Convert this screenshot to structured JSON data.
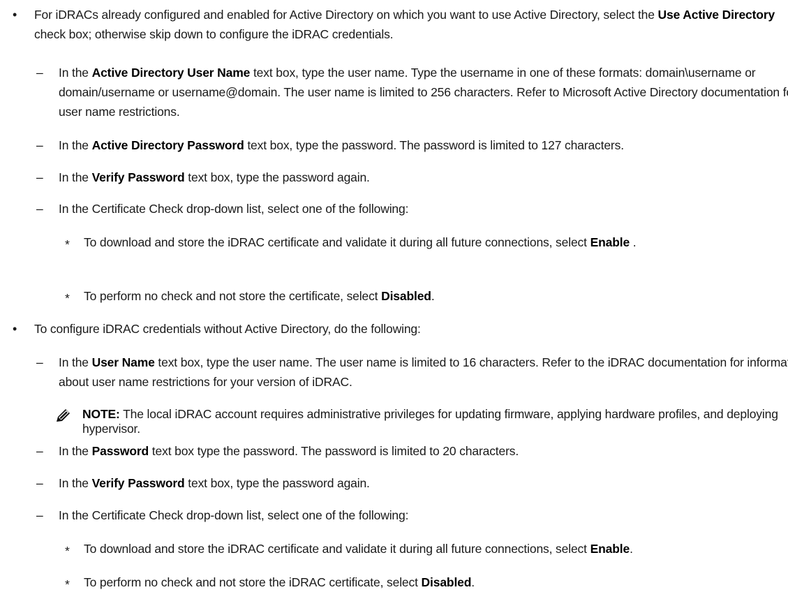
{
  "bullets": {
    "ad": {
      "mark": "•",
      "pre": "For iDRACs already configured and enabled for Active Directory on which you want to use Active Directory, select the ",
      "bold": "Use Active Directory",
      "post": " check box; otherwise skip down to configure the iDRAC credentials.",
      "subs": {
        "username": {
          "mark": "–",
          "pre": "In the ",
          "bold": "Active Directory User Name",
          "post": " text box, type the user name. Type the username in one of these formats: domain\\username or domain/username or username@domain. The user name is limited to 256 characters. Refer to Microsoft Active Directory documentation for user name restrictions."
        },
        "password": {
          "mark": "–",
          "pre": "In the ",
          "bold": "Active Directory Password",
          "post": " text box, type the password. The password is limited to 127 characters."
        },
        "verify": {
          "mark": "–",
          "pre": "In the ",
          "bold": "Verify Password",
          "post": " text box, type the password again."
        },
        "cert": {
          "mark": "–",
          "text": "In the Certificate Check drop-down list, select one of the following:",
          "options": {
            "enable": {
              "mark": "*",
              "pre": "To download and store the iDRAC certificate and validate it during all future connections, select ",
              "bold": "Enable",
              "post": " ."
            },
            "disabled": {
              "mark": "*",
              "pre": "To perform no check and not store the certificate, select ",
              "bold": "Disabled",
              "post": "."
            }
          }
        }
      }
    },
    "local": {
      "mark": "•",
      "text": "To configure iDRAC credentials without Active Directory, do the following:",
      "subs": {
        "username": {
          "mark": "–",
          "pre": "In the ",
          "bold": "User Name",
          "post": " text box, type the user name. The user name is limited to 16 characters. Refer to the iDRAC documentation for information about user name restrictions for your version of iDRAC."
        },
        "note": {
          "icon": "note-pencil-icon",
          "bold": "NOTE:",
          "post": " The local iDRAC account requires administrative privileges for updating firmware, applying hardware profiles, and deploying hypervisor."
        },
        "password": {
          "mark": "–",
          "pre": "In the ",
          "bold": "Password",
          "post": " text box type the password. The password is limited to 20 characters."
        },
        "verify": {
          "mark": "–",
          "pre": "In the ",
          "bold": "Verify Password",
          "post": " text box, type the password again."
        },
        "cert": {
          "mark": "–",
          "text": "In the Certificate Check drop-down list, select one of the following:",
          "options": {
            "enable": {
              "mark": "*",
              "pre": "To download and store the iDRAC certificate and validate it during all future connections, select ",
              "bold": "Enable",
              "post": "."
            },
            "disabled": {
              "mark": "*",
              "pre": "To perform no check and not store the iDRAC certificate, select ",
              "bold": "Disabled",
              "post": "."
            }
          }
        }
      }
    }
  }
}
